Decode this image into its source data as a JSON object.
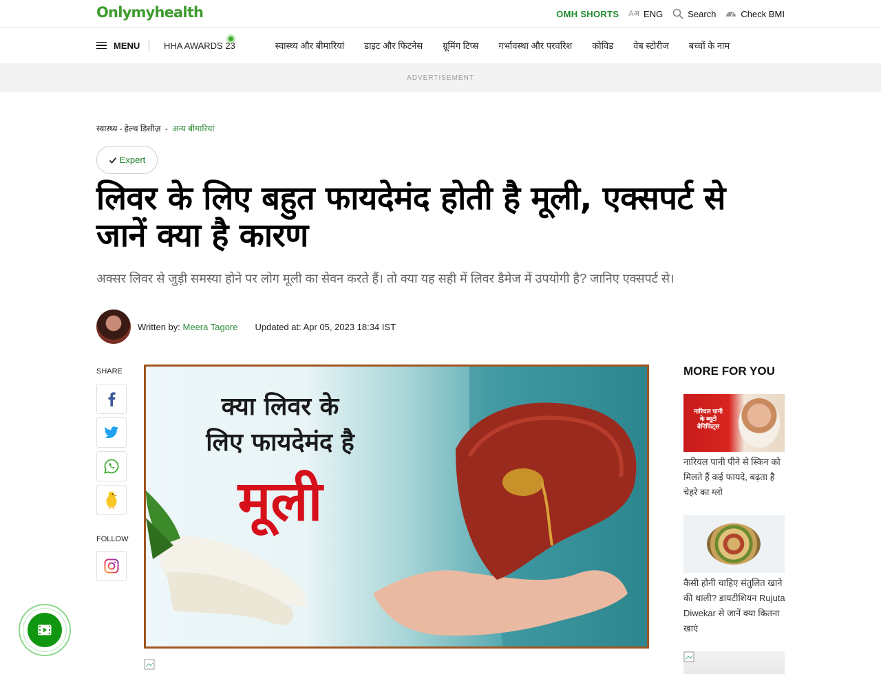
{
  "header": {
    "logo": "Onlymyhealth",
    "omh_shorts": "OMH SHORTS",
    "lang_glyph": "Aअ",
    "lang": "ENG",
    "search": "Search",
    "check_bmi": "Check BMI"
  },
  "nav": {
    "menu": "MENU",
    "items": [
      "HHA AWARDS 23",
      "स्वास्थ्य और बीमारियां",
      "डाइट और फिटनेस",
      "ग्रूमिंग टिप्स",
      "गर्भावस्था और परवरिश",
      "कोविड",
      "वेब स्टोरीज",
      "बच्चों के नाम"
    ]
  },
  "ad": {
    "label": "ADVERTISEMENT"
  },
  "breadcrumb": [
    "स्वास्थ्य",
    "हेल्थ डिसीज़",
    "अन्य बीमारियां"
  ],
  "badge": {
    "label": "Expert"
  },
  "article": {
    "title": "लिवर के लिए बहुत फायदेमंद होती है मूली, एक्सपर्ट से जानें क्या है कारण",
    "summary": "अक्सर लिवर से जुड़ी समस्या होने पर लोग मूली का सेवन करते हैं। तो क्या यह सही में लिवर डैमेज में उपयोगी है? जानिए एक्सपर्ट से।",
    "written_by_label": "Written by:",
    "author": "Meera Tagore",
    "updated": "Updated at: Apr 05, 2023 18:34 IST"
  },
  "share": {
    "label": "SHARE",
    "follow_label": "FOLLOW"
  },
  "hero": {
    "line1": "क्या लिवर के",
    "line2": "लिए फायदेमंद है",
    "big": "मूली"
  },
  "sidebar": {
    "title": "MORE FOR YOU",
    "cards": [
      {
        "image_caption": [
          "नारियल पानी",
          "के ब्यूटी",
          "बेनिफिट्स"
        ],
        "text": "नारियल पानी पीने से स्किन को मिलते हैं कई फायदे, बढ़ता है चेहरे का ग्लो"
      },
      {
        "text": "कैसी होनी चाहिए संतुलित खाने की थाली? डायटीशियन Rujuta Diwekar से जानें क्या कितना खाएं"
      }
    ]
  },
  "colors": {
    "brand_green": "#3f9b2f",
    "link_green": "#2e8b3a",
    "radish_red": "#d6101b",
    "hero_border": "#a0541f"
  }
}
